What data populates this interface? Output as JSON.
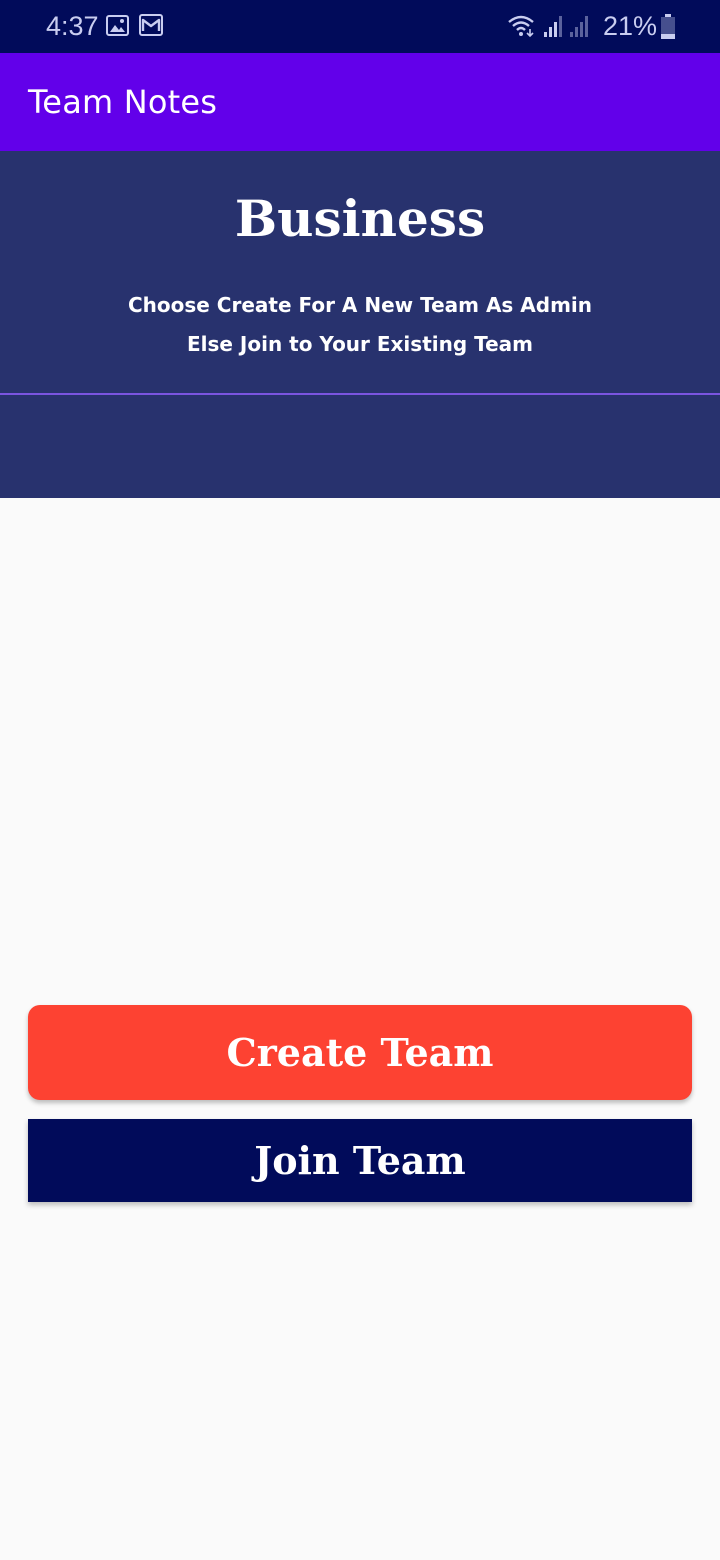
{
  "status_bar": {
    "time": "4:37",
    "battery_percent": "21%",
    "icons": [
      "gallery-icon",
      "gmail-icon",
      "wifi-icon",
      "signal-icon",
      "signal-icon",
      "battery-icon"
    ],
    "battery_level": 0.21
  },
  "app_bar": {
    "title": "Team Notes"
  },
  "header": {
    "heading": "Business",
    "line1": "Choose Create For A New Team As Admin",
    "line2": "Else Join to Your Existing Team"
  },
  "actions": {
    "create_label": "Create Team",
    "join_label": "Join Team"
  },
  "colors": {
    "status_bar": "#010b5a",
    "app_bar": "#6200ea",
    "header_bg": "#28326e",
    "divider": "#7b55e0",
    "create_button": "#fd4232",
    "join_button": "#010b5a",
    "background": "#fafafa"
  }
}
